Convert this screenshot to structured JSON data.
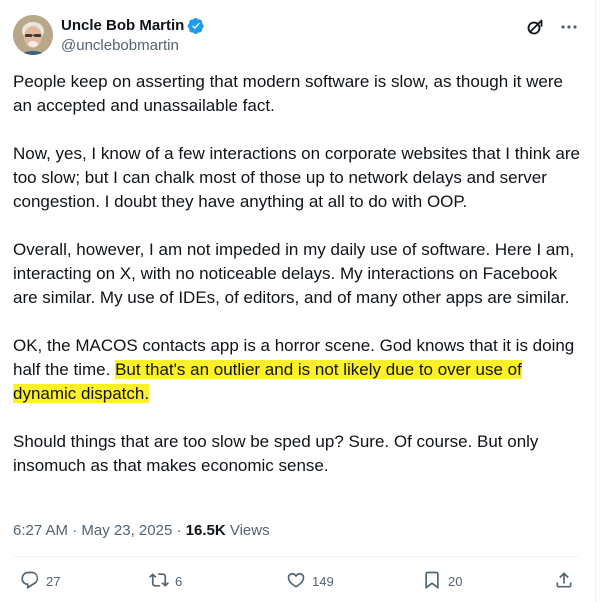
{
  "author": {
    "display_name": "Uncle Bob Martin",
    "handle": "@unclebobmartin"
  },
  "icons": {
    "verified": "verified-badge-icon",
    "grok": "grok-icon",
    "more": "more-options-icon",
    "reply": "reply-icon",
    "retweet": "retweet-icon",
    "like": "like-icon",
    "bookmark": "bookmark-icon",
    "share": "share-icon"
  },
  "colors": {
    "verified": "#1d9bf0",
    "highlight": "#fbf02a",
    "text": "#0f1419",
    "muted": "#536471"
  },
  "post": {
    "paragraphs": [
      "People keep on asserting that modern software is slow, as though it were an accepted and unassailable fact.",
      "Now, yes, I know of a few interactions on corporate websites that I think are too slow; but I can chalk most of those up to network delays and server congestion. I doubt they have anything at all to do with OOP.",
      "Overall, however, I am not impeded in my daily use of software.  Here I am, interacting on X, with no noticeable delays.  My interactions on Facebook are similar.  My use of IDEs, of editors, and of many other apps are similar.",
      "Should things that are too slow be sped up?  Sure.  Of course.  But only insomuch as that makes economic sense."
    ],
    "para4_plain": "OK, the MACOS contacts app is a horror scene.  God knows that it is doing half the time.  ",
    "para4_highlight": "But that's an outlier and is not likely due to over use of dynamic dispatch."
  },
  "meta": {
    "time": "6:27 AM",
    "sep1": " · ",
    "date": "May 23, 2025",
    "sep2": " · ",
    "views_count": "16.5K",
    "views_label": " Views"
  },
  "stats": {
    "replies": "27",
    "reposts": "6",
    "likes": "149",
    "bookmarks": "20"
  }
}
